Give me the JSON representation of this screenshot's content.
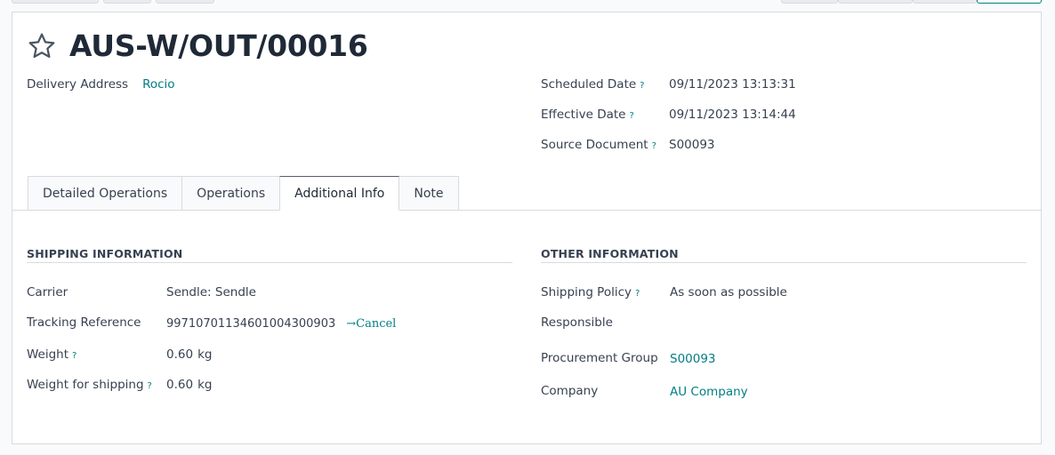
{
  "record": {
    "title": "AUS-W/OUT/00016"
  },
  "header": {
    "delivery_address_label": "Delivery Address",
    "delivery_address_value": "Rocio",
    "scheduled_date_label": "Scheduled Date",
    "scheduled_date_value": "09/11/2023 13:13:31",
    "effective_date_label": "Effective Date",
    "effective_date_value": "09/11/2023 13:14:44",
    "source_document_label": "Source Document",
    "source_document_value": "S00093",
    "help_mark": "?"
  },
  "tabs": [
    {
      "label": "Detailed Operations",
      "active": false
    },
    {
      "label": "Operations",
      "active": false
    },
    {
      "label": "Additional Info",
      "active": true
    },
    {
      "label": "Note",
      "active": false
    }
  ],
  "shipping": {
    "section_title": "SHIPPING INFORMATION",
    "carrier_label": "Carrier",
    "carrier_value": "Sendle: Sendle",
    "tracking_label": "Tracking Reference",
    "tracking_value": "99710701134601004300903",
    "tracking_cancel": "→Cancel",
    "weight_label": "Weight",
    "weight_value": "0.60",
    "weight_unit": "kg",
    "weight_shipping_label": "Weight for shipping",
    "weight_shipping_value": "0.60",
    "weight_shipping_unit": "kg"
  },
  "other": {
    "section_title": "OTHER INFORMATION",
    "shipping_policy_label": "Shipping Policy",
    "shipping_policy_value": "As soon as possible",
    "responsible_label": "Responsible",
    "procurement_group_label": "Procurement Group",
    "procurement_group_value": "S00093",
    "company_label": "Company",
    "company_value": "AU Company"
  },
  "colors": {
    "link": "#017e84",
    "text": "#374151",
    "border": "#d8dadd"
  },
  "icons": {
    "favorite": "star-outline-icon"
  }
}
